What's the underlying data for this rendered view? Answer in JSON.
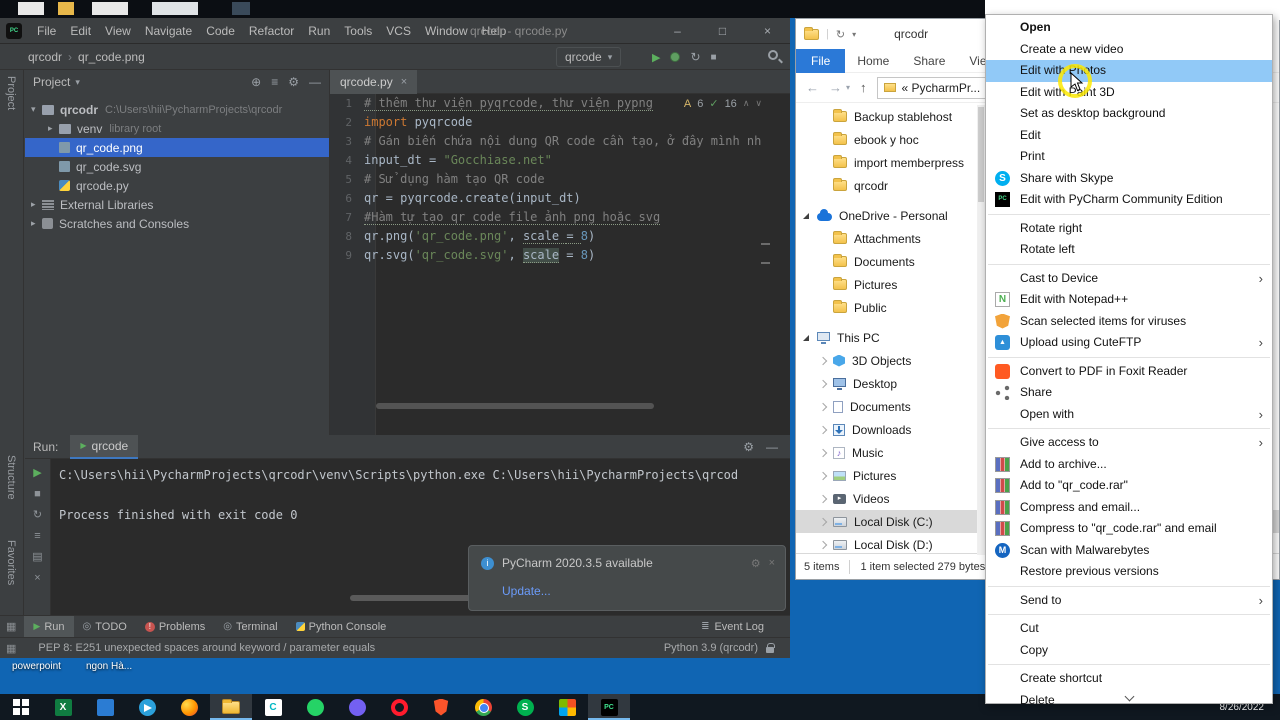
{
  "desktop": {
    "icon_labels": [
      "powerpoint",
      "ngon Hà..."
    ],
    "wallpaper_color": "#1065b3"
  },
  "pycharm": {
    "logo": "PC",
    "title": "qrcodr - qrcode.py",
    "menu_items": [
      "File",
      "Edit",
      "View",
      "Navigate",
      "Code",
      "Refactor",
      "Run",
      "Tools",
      "VCS",
      "Window",
      "Help"
    ],
    "window_controls": [
      "–",
      "□",
      "×"
    ],
    "breadcrumbs": [
      "qrcodr",
      "qr_code.png"
    ],
    "run_config": "qrcode",
    "side_labels": {
      "top": "Project",
      "middle": "Structure",
      "bottom": "Favorites"
    },
    "project": {
      "header": "Project",
      "tree": [
        {
          "label": "qrcodr",
          "detail": "C:\\Users\\hii\\PycharmProjects\\qrcodr",
          "icon": "folder",
          "level": 0,
          "arrow": "expanded"
        },
        {
          "label": "venv",
          "detail": "library root",
          "icon": "folder",
          "level": 1,
          "arrow": "collapsed"
        },
        {
          "label": "qr_code.png",
          "icon": "image",
          "level": 1,
          "selected": true
        },
        {
          "label": "qr_code.svg",
          "icon": "image",
          "level": 1
        },
        {
          "label": "qrcode.py",
          "icon": "python",
          "level": 1
        },
        {
          "label": "External Libraries",
          "icon": "lib",
          "level": 0,
          "arrow": "collapsed"
        },
        {
          "label": "Scratches and Consoles",
          "icon": "scratch",
          "level": 0,
          "arrow": "collapsed"
        }
      ]
    },
    "editor": {
      "tab": "qrcode.py",
      "inspections": {
        "letter": "A",
        "warnings": "6",
        "check": "16"
      },
      "lines": [
        {
          "n": "1",
          "seg": [
            {
              "t": "# thêm thư viện pyqrcode, thư viện pypng",
              "c": "comment",
              "u": true
            }
          ]
        },
        {
          "n": "2",
          "seg": [
            {
              "t": "import",
              "c": "keyword"
            },
            {
              "t": " pyqrcode",
              "c": "plain"
            }
          ]
        },
        {
          "n": "3",
          "seg": [
            {
              "t": "# Gán biến chứa nội dung QR code cần tạo, ở đây mình nh",
              "c": "comment"
            }
          ]
        },
        {
          "n": "4",
          "seg": [
            {
              "t": "input_dt = ",
              "c": "plain"
            },
            {
              "t": "\"Gocchiase.net\"",
              "c": "string"
            }
          ]
        },
        {
          "n": "5",
          "seg": [
            {
              "t": "# Sử dụng hàm tạo QR code",
              "c": "comment"
            }
          ]
        },
        {
          "n": "6",
          "seg": [
            {
              "t": "qr = pyqrcode.create(input_dt)",
              "c": "plain"
            }
          ]
        },
        {
          "n": "7",
          "seg": [
            {
              "t": "#Hàm tự tạo qr code file ảnh png hoặc svg",
              "c": "comment",
              "u": true
            }
          ]
        },
        {
          "n": "8",
          "seg": [
            {
              "t": "qr.png(",
              "c": "plain"
            },
            {
              "t": "'qr_code.png'",
              "c": "string"
            },
            {
              "t": ", ",
              "c": "plain"
            },
            {
              "t": "scale ",
              "c": "plain",
              "u": true
            },
            {
              "t": "= ",
              "c": "plain",
              "u": true
            },
            {
              "t": "8",
              "c": "number"
            },
            {
              "t": ")",
              "c": "plain"
            }
          ]
        },
        {
          "n": "9",
          "seg": [
            {
              "t": "qr.svg(",
              "c": "plain"
            },
            {
              "t": "'qr_code.svg'",
              "c": "string"
            },
            {
              "t": ", ",
              "c": "plain"
            },
            {
              "t": "scale",
              "c": "plain",
              "sel": true,
              "u": true
            },
            {
              "t": " = ",
              "c": "plain"
            },
            {
              "t": "8",
              "c": "number"
            },
            {
              "t": ")",
              "c": "plain"
            }
          ]
        }
      ]
    },
    "run_panel": {
      "label": "Run:",
      "tab": "qrcode",
      "console_lines": [
        "C:\\Users\\hii\\PycharmProjects\\qrcodr\\venv\\Scripts\\python.exe C:\\Users\\hii\\PycharmProjects\\qrcod",
        "",
        "Process finished with exit code 0"
      ]
    },
    "notification": {
      "title": "PyCharm 2020.3.5 available",
      "link": "Update..."
    },
    "bottom_bar": {
      "tabs": [
        {
          "label": "Run",
          "icon": "run"
        },
        {
          "label": "TODO",
          "icon": "todo"
        },
        {
          "label": "Problems",
          "icon": "problems"
        },
        {
          "label": "Terminal",
          "icon": "todo"
        },
        {
          "label": "Python Console",
          "icon": "python"
        }
      ],
      "right_tab": {
        "label": "Event Log",
        "icon": "eventlog"
      }
    },
    "status_bar": {
      "left": "PEP 8: E251 unexpected spaces around keyword / parameter equals",
      "right": "Python 3.9 (qrcodr)"
    }
  },
  "explorer": {
    "title": "qrcodr",
    "ribbon_tabs": [
      "File",
      "Home",
      "Share",
      "View"
    ],
    "address": "« PycharmPr...",
    "nav_tree": [
      {
        "label": "Backup stablehost",
        "icon": "folder",
        "level": 1
      },
      {
        "label": "ebook y hoc",
        "icon": "folder",
        "level": 1
      },
      {
        "label": "import memberpress",
        "icon": "folder",
        "level": 1
      },
      {
        "label": "qrcodr",
        "icon": "folder",
        "level": 1
      },
      {
        "label": "OneDrive - Personal",
        "icon": "cloud",
        "level": 0,
        "arrow": "expanded",
        "gap": true
      },
      {
        "label": "Attachments",
        "icon": "folder",
        "level": 1
      },
      {
        "label": "Documents",
        "icon": "folder",
        "level": 1
      },
      {
        "label": "Pictures",
        "icon": "folder",
        "level": 1
      },
      {
        "label": "Public",
        "icon": "folder",
        "level": 1
      },
      {
        "label": "This PC",
        "icon": "pc",
        "level": 0,
        "arrow": "expanded",
        "gap": true
      },
      {
        "label": "3D Objects",
        "icon": "box3d",
        "level": 1,
        "arrow": "collapsed"
      },
      {
        "label": "Desktop",
        "icon": "desktop",
        "level": 1,
        "arrow": "collapsed"
      },
      {
        "label": "Documents",
        "icon": "doc",
        "level": 1,
        "arrow": "collapsed"
      },
      {
        "label": "Downloads",
        "icon": "download",
        "level": 1,
        "arrow": "collapsed"
      },
      {
        "label": "Music",
        "icon": "music",
        "level": 1,
        "arrow": "collapsed"
      },
      {
        "label": "Pictures",
        "icon": "pic",
        "level": 1,
        "arrow": "collapsed"
      },
      {
        "label": "Videos",
        "icon": "video",
        "level": 1,
        "arrow": "collapsed"
      },
      {
        "label": "Local Disk (C:)",
        "icon": "disk",
        "level": 1,
        "arrow": "collapsed",
        "selected": true
      },
      {
        "label": "Local Disk (D:)",
        "icon": "disk",
        "level": 1,
        "arrow": "collapsed"
      }
    ],
    "status_left": "5 items",
    "status_right": "1 item selected 279 bytes"
  },
  "context_menu": {
    "items": [
      {
        "label": "Open",
        "bold": true
      },
      {
        "label": "Create a new video"
      },
      {
        "label": "Edit with Photos",
        "highlight": true
      },
      {
        "label": "Edit with Paint 3D"
      },
      {
        "label": "Set as desktop background"
      },
      {
        "label": "Edit"
      },
      {
        "label": "Print"
      },
      {
        "label": "Share with Skype",
        "icon": "skype"
      },
      {
        "label": "Edit with PyCharm Community Edition",
        "icon": "pycharm"
      },
      {
        "sep": true
      },
      {
        "label": "Rotate right"
      },
      {
        "label": "Rotate left"
      },
      {
        "sep": true
      },
      {
        "label": "Cast to Device",
        "submenu": true
      },
      {
        "label": "Edit with Notepad++",
        "icon": "notepad"
      },
      {
        "label": "Scan selected items for viruses",
        "icon": "shield"
      },
      {
        "label": "Upload using CuteFTP",
        "icon": "cuteftp",
        "submenu": true
      },
      {
        "sep": true
      },
      {
        "label": "Convert to PDF in Foxit Reader",
        "icon": "foxit"
      },
      {
        "label": "Share",
        "icon": "share"
      },
      {
        "label": "Open with",
        "submenu": true
      },
      {
        "sep": true
      },
      {
        "label": "Give access to",
        "submenu": true
      },
      {
        "label": "Add to archive...",
        "icon": "winrar"
      },
      {
        "label": "Add to \"qr_code.rar\"",
        "icon": "winrar"
      },
      {
        "label": "Compress and email...",
        "icon": "winrar"
      },
      {
        "label": "Compress to \"qr_code.rar\" and email",
        "icon": "winrar"
      },
      {
        "label": "Scan with Malwarebytes",
        "icon": "malwarebytes"
      },
      {
        "label": "Restore previous versions"
      },
      {
        "sep": true
      },
      {
        "label": "Send to",
        "submenu": true
      },
      {
        "sep": true
      },
      {
        "label": "Cut"
      },
      {
        "label": "Copy"
      },
      {
        "sep": true
      },
      {
        "label": "Create shortcut"
      },
      {
        "label": "Delete"
      }
    ]
  },
  "taskbar": {
    "date": "8/26/2022",
    "icons": [
      {
        "name": "start"
      },
      {
        "name": "excel",
        "label": "X"
      },
      {
        "name": "blue-app"
      },
      {
        "name": "telegram"
      },
      {
        "name": "firefox"
      },
      {
        "name": "explorer",
        "active": true
      },
      {
        "name": "cyan-app",
        "label": "C"
      },
      {
        "name": "green-app"
      },
      {
        "name": "purple-app"
      },
      {
        "name": "opera"
      },
      {
        "name": "brave"
      },
      {
        "name": "chrome"
      },
      {
        "name": "green-s",
        "label": "S"
      },
      {
        "name": "ms-colors"
      },
      {
        "name": "pycharm",
        "label": "PC",
        "active": true
      }
    ]
  }
}
